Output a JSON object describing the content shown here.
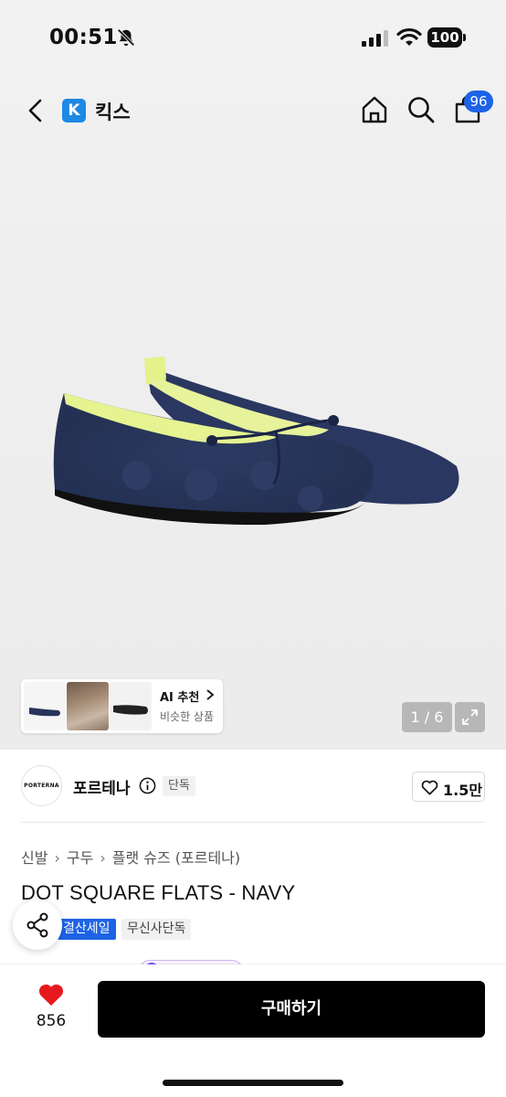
{
  "status_bar": {
    "time": "00:51",
    "battery": "100"
  },
  "nav": {
    "store_name": "킥스",
    "store_logo_letter": "K",
    "cart_count": "96"
  },
  "gallery": {
    "ai_title": "AI 추천",
    "ai_subtitle": "비슷한 상품",
    "page_indicator": "1 / 6"
  },
  "brand": {
    "logo_text": "PORTERNA",
    "name": "포르테나",
    "exclusive_label": "단독",
    "like_count": "1.5만"
  },
  "breadcrumb": [
    "신발",
    "구두",
    "플랫 슈즈 (포르테나)"
  ],
  "product": {
    "title": "DOT SQUARE FLATS - NAVY",
    "tags": [
      "결산세일",
      "무신사단독"
    ]
  },
  "bottom": {
    "wish_count": "856",
    "buy_label": "구매하기"
  },
  "colors": {
    "accent_blue": "#1e63e6",
    "heart_red": "#e8191e",
    "shoe_navy": "#27345a",
    "lining_yellow": "#e3f28a"
  },
  "icons": [
    "bell-slash-icon",
    "signal-icon",
    "wifi-icon",
    "back-icon",
    "home-icon",
    "search-icon",
    "cart-icon",
    "info-icon",
    "heart-icon",
    "share-icon",
    "expand-icon"
  ]
}
